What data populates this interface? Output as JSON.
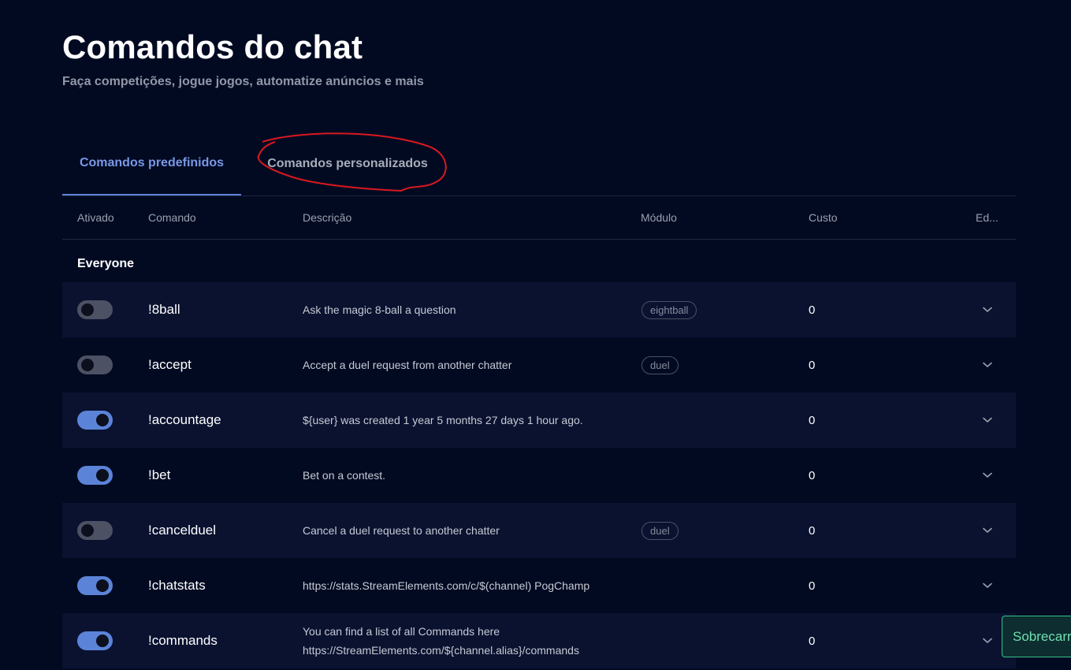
{
  "header": {
    "title": "Comandos do chat",
    "subtitle": "Faça competições, jogue jogos, automatize anúncios e mais"
  },
  "tabs": [
    {
      "label": "Comandos predefinidos",
      "active": true
    },
    {
      "label": "Comandos personalizados",
      "active": false
    }
  ],
  "table": {
    "columns": [
      "Ativado",
      "Comando",
      "Descrição",
      "Módulo",
      "Custo",
      "Ed..."
    ],
    "group_label": "Everyone",
    "rows": [
      {
        "enabled": false,
        "command": "!8ball",
        "description": "Ask the magic 8-ball a question",
        "module": "eightball",
        "cost": "0"
      },
      {
        "enabled": false,
        "command": "!accept",
        "description": "Accept a duel request from another chatter",
        "module": "duel",
        "cost": "0"
      },
      {
        "enabled": true,
        "command": "!accountage",
        "description": "${user} was created 1 year 5 months 27 days 1 hour ago.",
        "module": "",
        "cost": "0"
      },
      {
        "enabled": true,
        "command": "!bet",
        "description": "Bet on a contest.",
        "module": "",
        "cost": "0"
      },
      {
        "enabled": false,
        "command": "!cancelduel",
        "description": "Cancel a duel request to another chatter",
        "module": "duel",
        "cost": "0"
      },
      {
        "enabled": true,
        "command": "!chatstats",
        "description": "https://stats.StreamElements.com/c/$(channel) PogChamp",
        "module": "",
        "cost": "0"
      },
      {
        "enabled": true,
        "command": "!commands",
        "description": "You can find a list of all Commands here https://StreamElements.com/${channel.alias}/commands",
        "module": "",
        "cost": "0"
      }
    ]
  },
  "toast": {
    "label": "Sobrecarr"
  },
  "icons": {
    "row_expand": "chevron-down-icon"
  },
  "colors": {
    "background": "#020a22",
    "accent": "#5b84d8",
    "annotation": "#d8191f",
    "toast": "#34c48a"
  }
}
